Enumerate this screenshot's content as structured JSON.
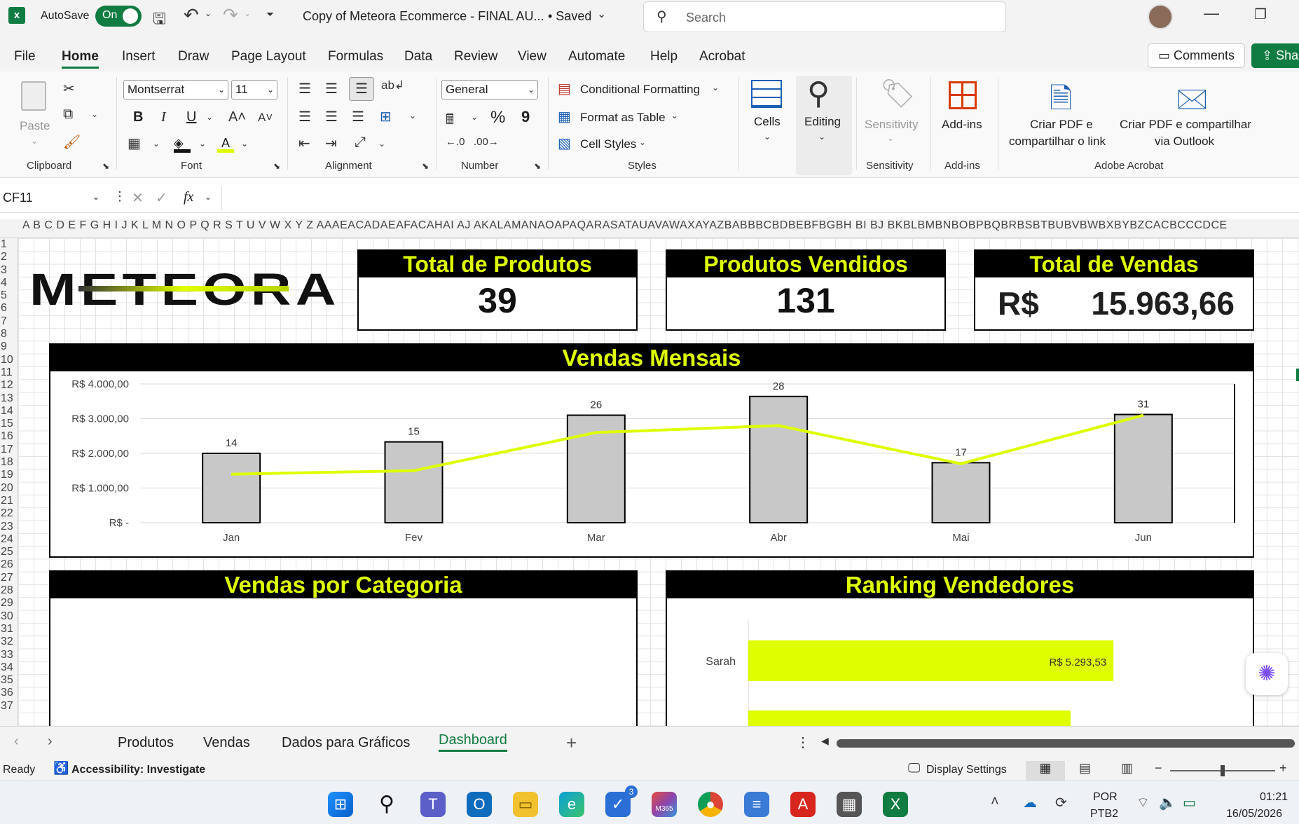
{
  "titlebar": {
    "autosave_label": "AutoSave",
    "toggle_label": "On",
    "filename": "Copy of Meteora Ecommerce - FINAL AU...",
    "saved": "• Saved",
    "search_placeholder": "Search"
  },
  "menu": {
    "items": [
      "File",
      "Home",
      "Insert",
      "Draw",
      "Page Layout",
      "Formulas",
      "Data",
      "Review",
      "View",
      "Automate",
      "Help",
      "Acrobat"
    ],
    "comments": "Comments",
    "share": "Shar"
  },
  "ribbon": {
    "clipboard": {
      "paste": "Paste",
      "label": "Clipboard"
    },
    "font": {
      "family": "Montserrat",
      "size": "11",
      "label": "Font",
      "bold": "B",
      "italic": "I",
      "underline": "U"
    },
    "alignment": {
      "label": "Alignment"
    },
    "number": {
      "format": "General",
      "label": "Number",
      "percent": "%",
      "comma": "9"
    },
    "styles": {
      "conditional": "Conditional Formatting",
      "format_table": "Format as Table",
      "cell_styles": "Cell Styles",
      "label": "Styles"
    },
    "cells": {
      "label": "Cells"
    },
    "editing": {
      "label": "Editing"
    },
    "sensitivity": {
      "button": "Sensitivity",
      "label": "Sensitivity"
    },
    "addins": {
      "button": "Add-ins",
      "label": "Add-ins"
    },
    "acrobat": {
      "pdf_link_1": "Criar PDF e",
      "pdf_link_2": "compartilhar o link",
      "pdf_outlook_1": "Criar PDF e compartilhar",
      "pdf_outlook_2": "via Outlook",
      "label": "Adobe Acrobat"
    }
  },
  "formula": {
    "namebox": "CF11",
    "fx": "fx"
  },
  "sheet": {
    "col_headers": "A B C D E F G H I J K L M N O P Q R S T U V W X Y Z AAAEACADAEAFACAHAI AJ AKALAMANAOAPAQARASATAUAVAWAXAYAZBABBBCBDBEBFBGBH BI BJ BKBLBMBNBOBPBQBRBSBTBUBVBWBXBYBZCACBCCCDCE",
    "rows": [
      "1",
      "2",
      "3",
      "4",
      "5",
      "6",
      "7",
      "8",
      "9",
      "10",
      "11",
      "12",
      "13",
      "14",
      "15",
      "16",
      "17",
      "18",
      "19",
      "20",
      "21",
      "22",
      "23",
      "24",
      "25",
      "26",
      "27",
      "28",
      "29",
      "30",
      "31",
      "32",
      "33",
      "34",
      "35",
      "36",
      "37"
    ],
    "logo": "METEORA",
    "kpis": [
      {
        "title": "Total de Produtos",
        "value": "39"
      },
      {
        "title": "Produtos Vendidos",
        "value": "131"
      },
      {
        "title": "Total de Vendas",
        "currency": "R$",
        "value": "15.963,66"
      }
    ],
    "monthly_title": "Vendas Mensais",
    "category_title": "Vendas por Categoria",
    "ranking_title": "Ranking Vendedores"
  },
  "chart_data": [
    {
      "type": "bar",
      "title": "Vendas Mensais",
      "categories": [
        "Jan",
        "Fev",
        "Mar",
        "Abr",
        "Mai",
        "Jun"
      ],
      "y_ticks": [
        "R$ -",
        "R$ 1.000,00",
        "R$ 2.000,00",
        "R$ 3.000,00",
        "R$ 4.000,00"
      ],
      "ylim": [
        0,
        4000
      ],
      "series": [
        {
          "values": [
            2000,
            2330,
            3100,
            3640,
            1730,
            3120
          ]
        },
        {
          "type": "line",
          "values": [
            14,
            15,
            26,
            28,
            17,
            31
          ],
          "labels": [
            "14",
            "15",
            "26",
            "28",
            "17",
            "31"
          ]
        }
      ],
      "colors": {
        "bar": "#c8c8c8",
        "line": "#dfff00"
      }
    },
    {
      "type": "bar",
      "title": "Ranking Vendedores",
      "categories": [
        "Sarah"
      ],
      "series": [
        {
          "values": [
            5293.53
          ],
          "labels": [
            "R$ 5.293,53"
          ]
        }
      ],
      "colors": {
        "bar": "#dfff00"
      }
    }
  ],
  "tabs": {
    "items": [
      "Produtos",
      "Vendas",
      "Dados para Gráficos",
      "Dashboard"
    ],
    "active": "Dashboard"
  },
  "status": {
    "ready": "Ready",
    "accessibility": "Accessibility: Investigate",
    "display": "Display Settings"
  },
  "taskbar": {
    "lang1": "POR",
    "lang2": "PTB2",
    "time": "01:21",
    "date": "16/05/2026",
    "badge": "3",
    "m365": "M365"
  }
}
